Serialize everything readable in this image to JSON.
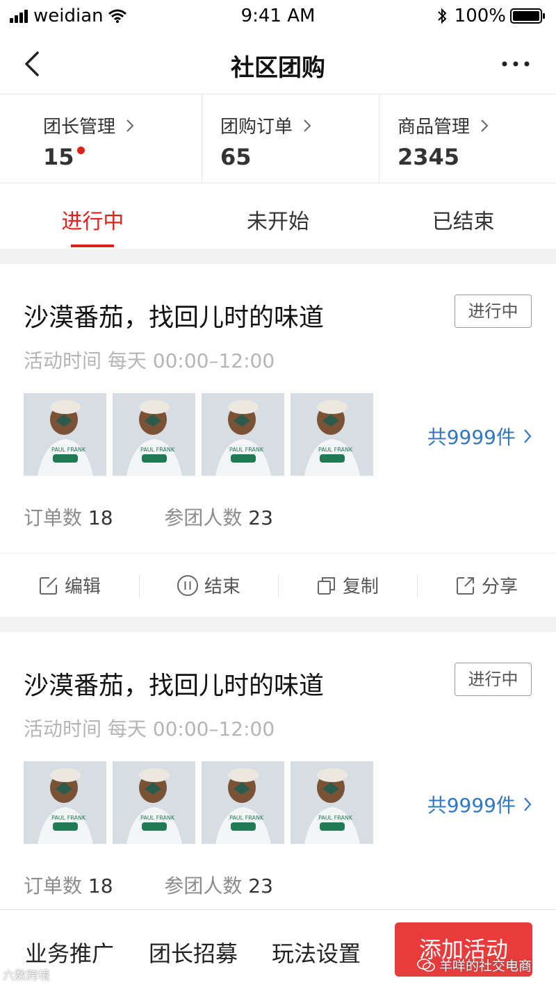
{
  "status_bar": {
    "carrier": "weidian",
    "time": "9:41 AM",
    "battery": "100%"
  },
  "nav": {
    "title": "社区团购"
  },
  "stats": [
    {
      "label": "团长管理",
      "value": "15",
      "has_dot": true
    },
    {
      "label": "团购订单",
      "value": "65",
      "has_dot": false
    },
    {
      "label": "商品管理",
      "value": "2345",
      "has_dot": false
    }
  ],
  "tabs": [
    {
      "label": "进行中",
      "active": true
    },
    {
      "label": "未开始",
      "active": false
    },
    {
      "label": "已结束",
      "active": false
    }
  ],
  "cards": [
    {
      "title": "沙漠番茄，找回儿时的味道",
      "badge": "进行中",
      "time_label": "活动时间  每天  00:00–12:00",
      "item_count": "共9999件",
      "orders_label": "订单数",
      "orders_value": "18",
      "members_label": "参团人数",
      "members_value": "23",
      "actions": [
        "编辑",
        "结束",
        "复制",
        "分享"
      ]
    },
    {
      "title": "沙漠番茄，找回儿时的味道",
      "badge": "进行中",
      "time_label": "活动时间  每天  00:00–12:00",
      "item_count": "共9999件",
      "orders_label": "订单数",
      "orders_value": "18",
      "members_label": "参团人数",
      "members_value": "23"
    }
  ],
  "bottom_bar": {
    "promo": "业务推广",
    "recruit": "团长招募",
    "settings": "玩法设置",
    "add": "添加活动"
  },
  "watermarks": {
    "left": "六数跨境",
    "right": "羊咩的社交电商"
  },
  "colors": {
    "accent": "#e0211b",
    "link": "#2f77c2",
    "add_button": "#e83b3b"
  }
}
